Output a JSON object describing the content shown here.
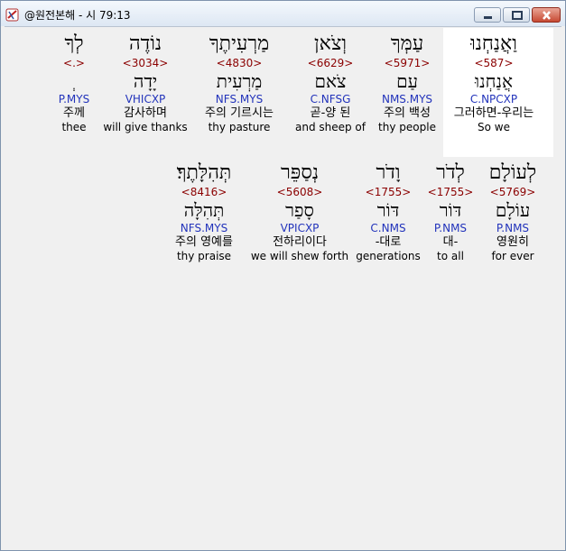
{
  "window": {
    "title": "@원전본해 - 시 79:13"
  },
  "verse_words": [
    {
      "hebrew": "לְךָ",
      "strong": "<.>",
      "lemma": "ְ",
      "morph": "P.MYS",
      "korean": "주께",
      "english": "thee"
    },
    {
      "hebrew": "נוֹדֶה",
      "strong": "<3034>",
      "lemma": "יָדָה",
      "morph": "VHICXP",
      "korean": "감사하며",
      "english": "will give thanks"
    },
    {
      "hebrew": "מַרְעִיתֶךָ",
      "strong": "<4830>",
      "lemma": "מַרְעִית",
      "morph": "NFS.MYS",
      "korean": "주의 기르시는",
      "english": "thy pasture"
    },
    {
      "hebrew": "וְצֹאן",
      "strong": "<6629>",
      "lemma": "צֹאם",
      "morph": "C.NFSG",
      "korean": "곧-양 된",
      "english": "and sheep of"
    },
    {
      "hebrew": "עַמְּךָ",
      "strong": "<5971>",
      "lemma": "עַם",
      "morph": "NMS.MYS",
      "korean": "주의 백성",
      "english": "thy people"
    },
    {
      "hebrew": "וַאֲנַחְנוּ",
      "strong": "<587>",
      "lemma": "אֲנַחְנוּ",
      "morph": "C.NPCXP",
      "korean": "그러하면-우리는",
      "english": "So we"
    },
    {
      "hebrew": "תְּהִלָּתֶךָ׃",
      "strong": "<8416>",
      "lemma": "תְּהִלָּה",
      "morph": "NFS.MYS",
      "korean": "주의 영예를",
      "english": "thy praise"
    },
    {
      "hebrew": "נְסַפֵּר",
      "strong": "<5608>",
      "lemma": "סָפַר",
      "morph": "VPICXP",
      "korean": "전하리이다",
      "english": "we will shew forth"
    },
    {
      "hebrew": "וָדֹר",
      "strong": "<1755>",
      "lemma": "דּוֹר",
      "morph": "C.NMS",
      "korean": "-대로",
      "english": "generations"
    },
    {
      "hebrew": "לְדֹר",
      "strong": "<1755>",
      "lemma": "דּוֹר",
      "morph": "P.NMS",
      "korean": "대-",
      "english": "to all"
    },
    {
      "hebrew": "לְעוֹלָם",
      "strong": "<5769>",
      "lemma": "עוֹלָם",
      "morph": "P.NMS",
      "korean": "영원히",
      "english": "for ever"
    }
  ]
}
